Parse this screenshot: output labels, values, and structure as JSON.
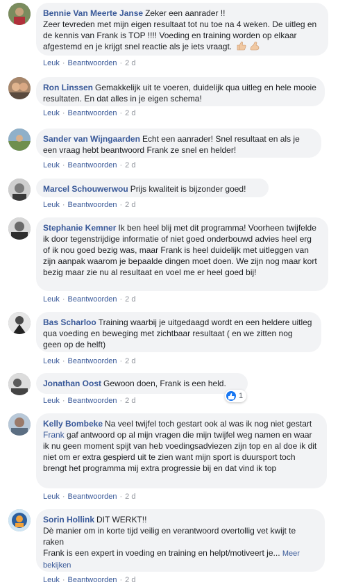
{
  "comments": [
    {
      "author": "Bennie Van Meerte Janse",
      "text": "Zeker een aanrader !!\nZeer tevreden met mijn eigen resultaat tot nu toe na 4 weken. De uitleg en de kennis van Frank is TOP !!!! Voeding en training worden op elkaar afgestemd en je krijgt snel reactie als je iets vraagt.",
      "emoji": [
        "thumbs-up-light",
        "flexed-biceps-light"
      ],
      "like": "Leuk",
      "reply": "Beantwoorden",
      "time": "2 d"
    },
    {
      "author": "Ron Linssen",
      "text": "Gemakkelijk uit te voeren, duidelijk qua uitleg en hele mooie resultaten. En dat alles in je eigen schema!",
      "like": "Leuk",
      "reply": "Beantwoorden",
      "time": "2 d"
    },
    {
      "author": "Sander van Wijngaarden",
      "text": "Echt een aanrader! Snel resultaat en als je een vraag hebt beantwoord Frank ze snel en helder!",
      "like": "Leuk",
      "reply": "Beantwoorden",
      "time": "2 d"
    },
    {
      "author": "Marcel Schouwerwou",
      "text": "Prijs kwaliteit is bijzonder goed!",
      "like": "Leuk",
      "reply": "Beantwoorden",
      "time": "2 d"
    },
    {
      "author": "Stephanie Kemner",
      "text": "Ik ben heel blij met dit programma! Voorheen twijfelde ik door tegenstrijdige informatie of niet goed onderbouwd advies heel erg of ik nou goed bezig was, maar Frank is heel duidelijk met uitleggen van zijn aanpak waarom je bepaalde dingen moet doen. We zijn nog maar kort bezig maar zie nu al resultaat en voel me er heel goed bij!",
      "like": "Leuk",
      "reply": "Beantwoorden",
      "time": "2 d"
    },
    {
      "author": "Bas Scharloo",
      "text": "Training waarbij je uitgedaagd wordt en een heldere uitleg qua voeding en beweging met zichtbaar resultaat ( en we zitten nog geen op de helft)",
      "like": "Leuk",
      "reply": "Beantwoorden",
      "time": "2 d"
    },
    {
      "author": "Jonathan Oost",
      "text": "Gewoon doen, Frank is een held.",
      "like": "Leuk",
      "reply": "Beantwoorden",
      "time": "2 d",
      "reactions": "1"
    },
    {
      "author": "Kelly Bombeke",
      "text_before": "Na veel twijfel toch gestart ook al was ik nog niet gestart ",
      "mention": "Frank",
      "text_after": " gaf antwoord op al mijn vragen die mijn twijfel weg namen en waar ik nu geen moment spijt van heb voedingsadviezen zijn top en al doe ik dit niet om er extra gespierd uit te zien want mijn sport is duursport toch brengt het programma mij extra progressie bij en dat vind ik top",
      "like": "Leuk",
      "reply": "Beantwoorden",
      "time": "2 d"
    },
    {
      "author": "Sorin Hollink",
      "text": "DIT WERKT!!\nDè manier om in korte tijd veilig en verantwoord overtollig vet kwijt te raken\nFrank is een expert in voeding en training en helpt/motiveert je...",
      "see_more": "Meer bekijken",
      "like": "Leuk",
      "reply": "Beantwoorden",
      "time": "2 d"
    }
  ],
  "colors": {
    "bubble": "#f2f3f5",
    "author": "#385898",
    "meta": "#90949c",
    "like_blue": "#1877f2"
  }
}
